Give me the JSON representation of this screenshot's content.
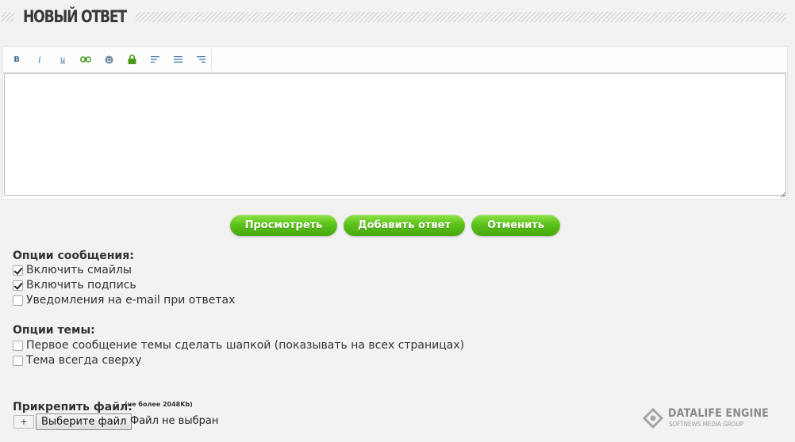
{
  "heading": {
    "title": "НОВЫЙ ОТВЕТ"
  },
  "editor": {
    "toolbar": [
      {
        "name": "bold-icon",
        "glyph": "B"
      },
      {
        "name": "italic-icon",
        "glyph": "i"
      },
      {
        "name": "underline-icon",
        "glyph": "u"
      },
      {
        "name": "link-icon",
        "glyph": ""
      },
      {
        "name": "smiley-icon",
        "glyph": ""
      },
      {
        "name": "lock-icon",
        "glyph": ""
      },
      {
        "name": "align-left-icon",
        "glyph": ""
      },
      {
        "name": "align-center-icon",
        "glyph": ""
      },
      {
        "name": "align-right-icon",
        "glyph": ""
      }
    ],
    "body_text": ""
  },
  "buttons": {
    "preview": "Просмотреть",
    "add_reply": "Добавить ответ",
    "cancel": "Отменить"
  },
  "message_options": {
    "title": "Опции сообщения:",
    "items": [
      {
        "label": "Включить смайлы",
        "checked": true
      },
      {
        "label": "Включить подпись",
        "checked": true
      },
      {
        "label": "Уведомления на e-mail при ответах",
        "checked": false
      }
    ]
  },
  "topic_options": {
    "title": "Опции темы:",
    "items": [
      {
        "label": "Первое сообщение темы сделать шапкой (показывать на всех страницах)",
        "checked": false
      },
      {
        "label": "Тема всегда сверху",
        "checked": false
      }
    ]
  },
  "attach": {
    "label": "Прикрепить файл:",
    "note": "(не более 2048Kb)",
    "plus_label": "+",
    "choose_label": "Выберите файл",
    "no_file_text": "Файл не выбран"
  },
  "brand": {
    "name": "DATALIFE ENGINE",
    "sub": "SOFTNEWS MEDIA GROUP"
  },
  "colors": {
    "button_green": "#5dc21b",
    "toolbar_icon": "#3f6f99",
    "lock_green": "#4a9a1e",
    "background": "#f2f2f2"
  }
}
